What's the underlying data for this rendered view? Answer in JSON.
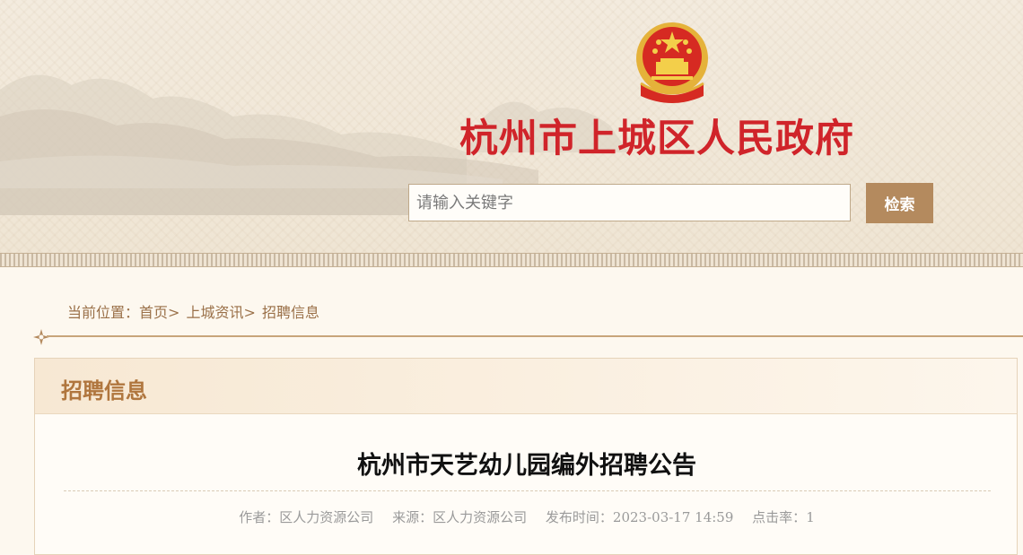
{
  "header": {
    "site_title": "杭州市上城区人民政府",
    "search": {
      "placeholder": "请输入关键字",
      "button_label": "检索"
    }
  },
  "breadcrumb": {
    "label": "当前位置：",
    "items": [
      "首页",
      "上城资讯",
      "招聘信息"
    ],
    "separator": ">"
  },
  "section": {
    "title": "招聘信息"
  },
  "article": {
    "title": "杭州市天艺幼儿园编外招聘公告",
    "meta": {
      "author_label": "作者：",
      "author": "区人力资源公司",
      "source_label": "来源：",
      "source": "区人力资源公司",
      "time_label": "发布时间：",
      "time": "2023-03-17 14:59",
      "clicks_label": "点击率：",
      "clicks": "1"
    }
  },
  "colors": {
    "title_red": "#d0242a",
    "accent_brown": "#b48a5e",
    "section_title": "#b0763e",
    "breadcrumb": "#9a7048"
  },
  "icons": [
    "national-emblem-icon",
    "divider-ornament-icon"
  ]
}
